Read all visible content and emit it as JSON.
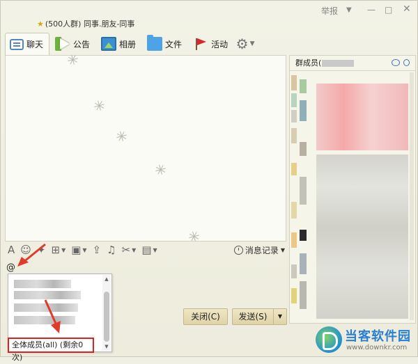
{
  "window": {
    "title": "(500人群) 同事.朋友-同事",
    "report_label": "举报"
  },
  "tabs": [
    {
      "label": "聊天",
      "icon": "chat-bubble-icon",
      "active": true
    },
    {
      "label": "公告",
      "icon": "megaphone-icon"
    },
    {
      "label": "相册",
      "icon": "photo-album-icon"
    },
    {
      "label": "文件",
      "icon": "folder-icon"
    },
    {
      "label": "活动",
      "icon": "flag-icon"
    }
  ],
  "input_toolbar": {
    "history_label": "消息记录"
  },
  "input": {
    "text": "@"
  },
  "mention_popup": {
    "all_members_label": "全体成员(all) (剩余0次)"
  },
  "buttons": {
    "close_label": "关闭(C)",
    "send_label": "发送(S)"
  },
  "members": {
    "header_label": "群成员("
  },
  "watermark": {
    "title": "当客软件园",
    "url": "www.downkr.com"
  },
  "colors": {
    "accent_red": "#e02020",
    "button_bg": "#e5dab2",
    "window_bg": "#f1f0e4"
  }
}
